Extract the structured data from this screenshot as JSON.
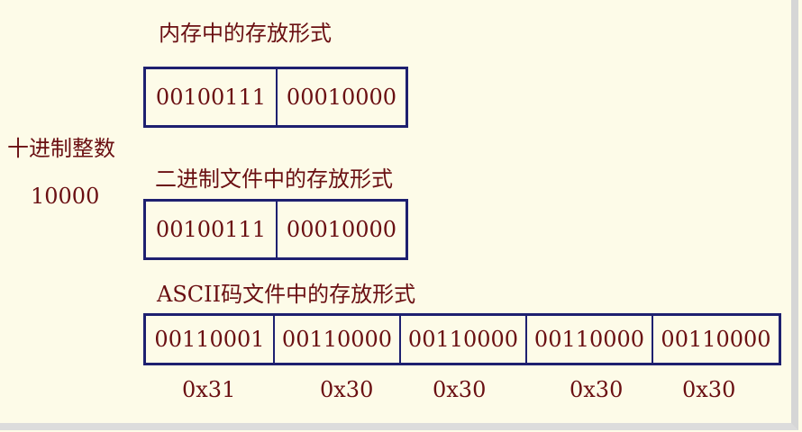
{
  "left_label": {
    "line1": "十进制整数",
    "line2": "10000"
  },
  "memory": {
    "title": "内存中的存放形式",
    "bytes": [
      "00100111",
      "00010000"
    ]
  },
  "binary_file": {
    "title": "二进制文件中的存放形式",
    "bytes": [
      "00100111",
      "00010000"
    ]
  },
  "ascii_file": {
    "title": "ASCII码文件中的存放形式",
    "bytes": [
      "00110001",
      "00110000",
      "00110000",
      "00110000",
      "00110000"
    ],
    "hex": [
      "0x31",
      "0x30",
      "0x30",
      "0x30",
      "0x30"
    ]
  }
}
